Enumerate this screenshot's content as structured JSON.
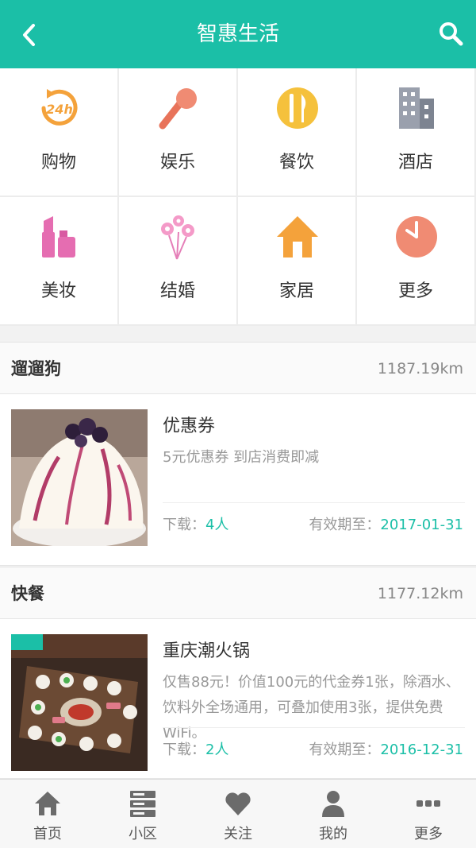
{
  "header": {
    "title": "智惠生活",
    "back_icon": "chevron-left-icon",
    "search_icon": "search-icon"
  },
  "categories": [
    {
      "label": "购物",
      "icon": "24h-clock-icon"
    },
    {
      "label": "娱乐",
      "icon": "microphone-icon"
    },
    {
      "label": "餐饮",
      "icon": "cutlery-icon"
    },
    {
      "label": "酒店",
      "icon": "building-icon"
    },
    {
      "label": "美妆",
      "icon": "lipstick-icon"
    },
    {
      "label": "结婚",
      "icon": "flowers-icon"
    },
    {
      "label": "家居",
      "icon": "house-icon"
    },
    {
      "label": "更多",
      "icon": "clock-icon"
    }
  ],
  "sections": [
    {
      "name": "遛遛狗",
      "distance": "1187.19km",
      "item": {
        "title": "优惠券",
        "desc": "5元优惠券 到店消费即减",
        "download_label": "下载：",
        "download_value": "4人",
        "expiry_label": "有效期至：",
        "expiry_value": "2017-01-31"
      }
    },
    {
      "name": "快餐",
      "distance": "1177.12km",
      "item": {
        "title": "重庆潮火锅",
        "desc": "仅售88元！价值100元的代金券1张，除酒水、饮料外全场通用，可叠加使用3张，提供免费WiFi。",
        "download_label": "下载：",
        "download_value": "2人",
        "expiry_label": "有效期至：",
        "expiry_value": "2016-12-31"
      }
    }
  ],
  "tabbar": [
    {
      "label": "首页",
      "icon": "home-icon"
    },
    {
      "label": "小区",
      "icon": "server-icon"
    },
    {
      "label": "关注",
      "icon": "heart-icon"
    },
    {
      "label": "我的",
      "icon": "user-icon"
    },
    {
      "label": "更多",
      "icon": "more-icon"
    }
  ],
  "colors": {
    "accent": "#1bbfa7",
    "text": "#333333",
    "muted": "#999999"
  }
}
